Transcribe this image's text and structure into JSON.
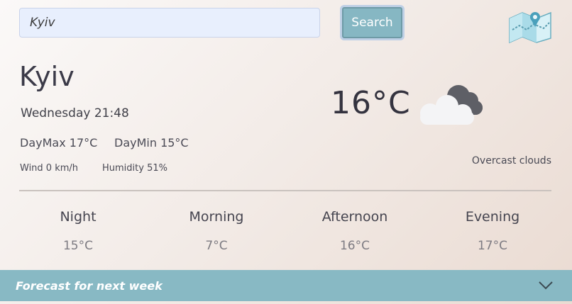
{
  "search": {
    "value": "Kyiv",
    "button_label": "Search"
  },
  "icons": {
    "map": "map-icon",
    "weather": "cloud-icon",
    "chevron": "chevron-down-icon"
  },
  "current": {
    "city": "Kyiv",
    "datetime": "Wednesday 21:48",
    "day_max": "DayMax 17°C",
    "day_min": "DayMin 15°C",
    "wind": "Wind 0 km/h",
    "humidity": "Humidity 51%",
    "temperature": "16°C",
    "description": "Overcast clouds"
  },
  "periods": [
    {
      "name": "Night",
      "temp": "15°C"
    },
    {
      "name": "Morning",
      "temp": "7°C"
    },
    {
      "name": "Afternoon",
      "temp": "16°C"
    },
    {
      "name": "Evening",
      "temp": "17°C"
    }
  ],
  "forecast": {
    "label": "Forecast for next week"
  },
  "colors": {
    "accent": "#88b9c4",
    "search_field": "#e8effd"
  }
}
